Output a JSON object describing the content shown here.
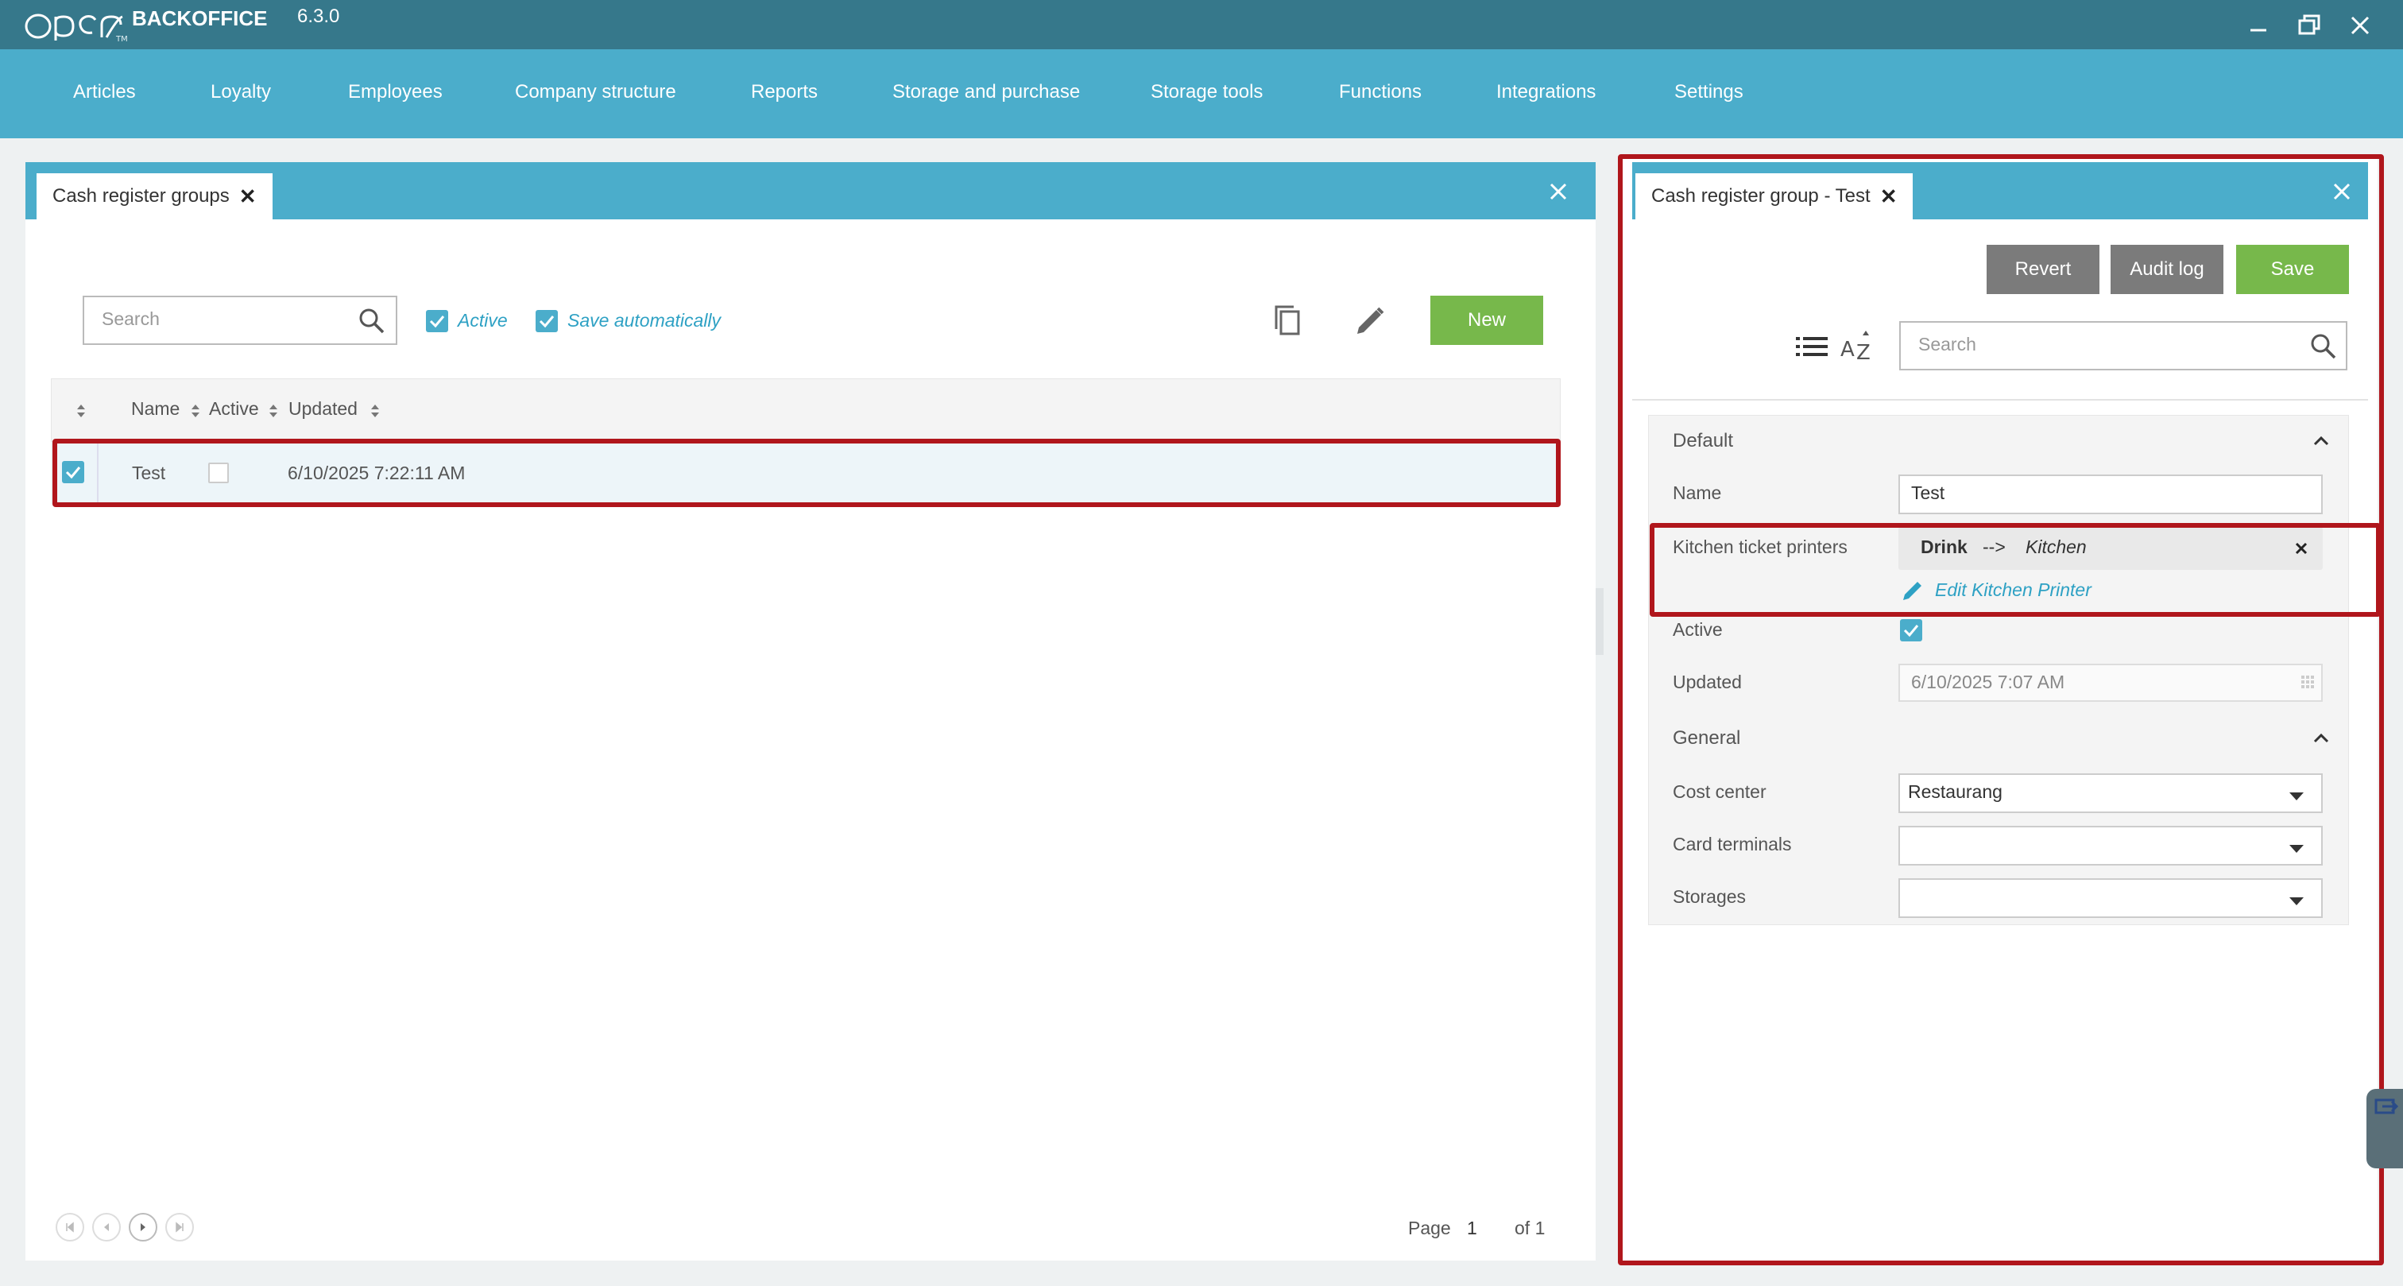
{
  "app": {
    "brand": "OPEN",
    "trademark": "TM",
    "title": "BACKOFFICE",
    "version": "6.3.0"
  },
  "menu": [
    "Articles",
    "Loyalty",
    "Employees",
    "Company structure",
    "Reports",
    "Storage and purchase",
    "Storage tools",
    "Functions",
    "Integrations",
    "Settings"
  ],
  "left_panel": {
    "tab_label": "Cash register groups",
    "search_placeholder": "Search",
    "active_label": "Active",
    "save_auto_label": "Save automatically",
    "new_label": "New",
    "columns": [
      "Name",
      "Active",
      "Updated"
    ],
    "rows": [
      {
        "name": "Test",
        "active": false,
        "updated": "6/10/2025 7:22:11 AM",
        "selected": true
      }
    ],
    "pager": {
      "page_label": "Page",
      "page": "1",
      "of_label": "of 1"
    }
  },
  "right_panel": {
    "tab_label": "Cash register group - Test",
    "revert_label": "Revert",
    "audit_label": "Audit log",
    "save_label": "Save",
    "search_placeholder": "Search",
    "sections": {
      "default": "Default",
      "general": "General"
    },
    "name_label": "Name",
    "name_value": "Test",
    "printers_label": "Kitchen ticket printers",
    "printer_from": "Drink",
    "printer_arrow": "-->",
    "printer_to": "Kitchen",
    "edit_printer_label": "Edit Kitchen Printer",
    "active_label": "Active",
    "active_value": true,
    "updated_label": "Updated",
    "updated_value": "6/10/2025 7:07 AM",
    "cost_center_label": "Cost center",
    "cost_center_value": "Restaurang",
    "card_terminals_label": "Card terminals",
    "card_terminals_value": "",
    "storages_label": "Storages",
    "storages_value": ""
  },
  "colors": {
    "titlebar": "#36788b",
    "menubar": "#4badcb",
    "accent": "#4badcb",
    "green": "#77b84b",
    "highlight": "#b0161c"
  }
}
